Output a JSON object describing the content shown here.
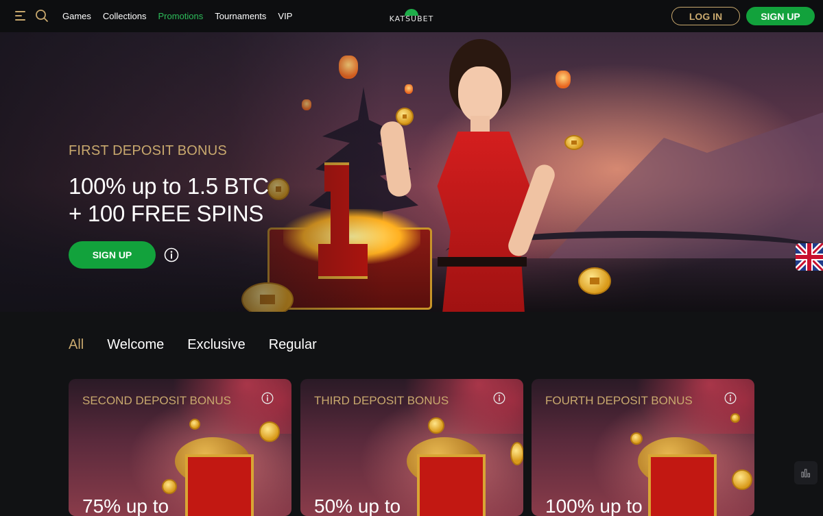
{
  "header": {
    "nav": [
      "Games",
      "Collections",
      "Promotions",
      "Tournaments",
      "VIP"
    ],
    "active_nav": "Promotions",
    "logo_text": "KATSUBET",
    "login_label": "LOG IN",
    "signup_label": "SIGN UP"
  },
  "hero": {
    "eyebrow": "FIRST DEPOSIT BONUS",
    "title_line1": "100% up to 1.5 BTC",
    "title_line2": "+ 100 FREE SPINS",
    "signup_label": "SIGN UP"
  },
  "filters": {
    "tabs": [
      "All",
      "Welcome",
      "Exclusive",
      "Regular"
    ],
    "active": "All"
  },
  "cards": [
    {
      "title": "SECOND DEPOSIT BONUS",
      "offer": "75% up to"
    },
    {
      "title": "THIRD DEPOSIT BONUS",
      "offer": "50% up to"
    },
    {
      "title": "FOURTH DEPOSIT BONUS",
      "offer": "100% up to"
    }
  ],
  "colors": {
    "accent_green": "#12a23c",
    "accent_gold": "#c9a96e",
    "active_nav": "#2dbd5a",
    "background": "#111214"
  },
  "icons": {
    "menu": "menu-icon",
    "search": "search-icon",
    "info": "info-icon",
    "language": "uk-flag-icon",
    "stats": "bar-chart-icon"
  }
}
